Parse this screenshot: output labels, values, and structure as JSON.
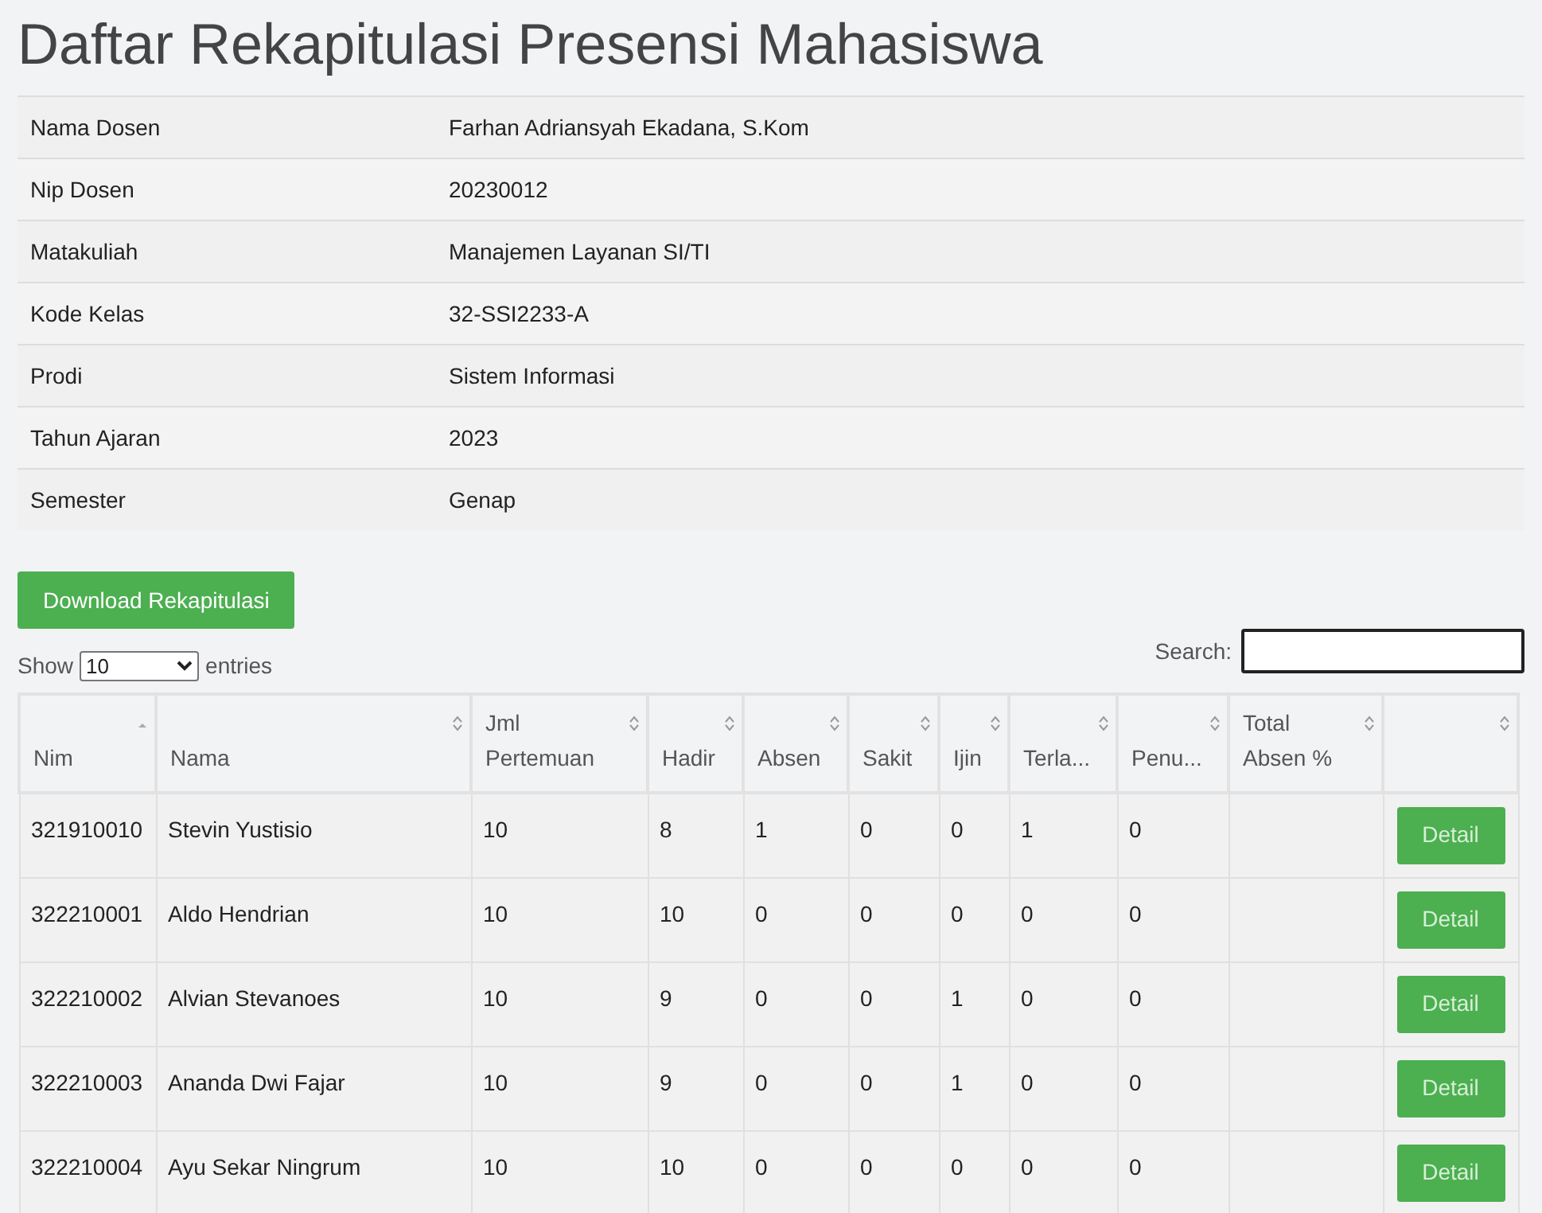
{
  "title": "Daftar Rekapitulasi Presensi Mahasiswa",
  "info": [
    {
      "label": "Nama Dosen",
      "value": "Farhan Adriansyah Ekadana, S.Kom"
    },
    {
      "label": "Nip Dosen",
      "value": "20230012"
    },
    {
      "label": "Matakuliah",
      "value": "Manajemen Layanan SI/TI"
    },
    {
      "label": "Kode Kelas",
      "value": "32-SSI2233-A"
    },
    {
      "label": "Prodi",
      "value": "Sistem Informasi"
    },
    {
      "label": "Tahun Ajaran",
      "value": "2023"
    },
    {
      "label": "Semester",
      "value": "Genap"
    }
  ],
  "download_button": "Download Rekapitulasi",
  "length": {
    "before": "Show",
    "value": "10",
    "after": "entries"
  },
  "search": {
    "label": "Search:"
  },
  "table": {
    "columns": [
      {
        "label": [
          "Nim"
        ],
        "sorted": true
      },
      {
        "label": [
          "Nama"
        ],
        "sorted": false
      },
      {
        "label": [
          "Jml",
          "Pertemuan"
        ],
        "sorted": false
      },
      {
        "label": [
          "Hadir"
        ],
        "sorted": false
      },
      {
        "label": [
          "Absen"
        ],
        "sorted": false
      },
      {
        "label": [
          "Sakit"
        ],
        "sorted": false
      },
      {
        "label": [
          "Ijin"
        ],
        "sorted": false
      },
      {
        "label": [
          "Terla..."
        ],
        "sorted": false
      },
      {
        "label": [
          "Penu..."
        ],
        "sorted": false
      },
      {
        "label": [
          "Total",
          "Absen %"
        ],
        "sorted": false
      },
      {
        "sorted": false
      }
    ],
    "rows": [
      {
        "cells": [
          "321910010",
          "Stevin Yustisio",
          "10",
          "8",
          "1",
          "0",
          "0",
          "1",
          "0"
        ],
        "action": "Detail"
      },
      {
        "cells": [
          "322210001",
          "Aldo Hendrian",
          "10",
          "10",
          "0",
          "0",
          "0",
          "0",
          "0"
        ],
        "action": "Detail"
      },
      {
        "cells": [
          "322210002",
          "Alvian Stevanoes",
          "10",
          "9",
          "0",
          "0",
          "1",
          "0",
          "0"
        ],
        "action": "Detail"
      },
      {
        "cells": [
          "322210003",
          "Ananda Dwi Fajar",
          "10",
          "9",
          "0",
          "0",
          "1",
          "0",
          "0"
        ],
        "action": "Detail"
      },
      {
        "cells": [
          "322210004",
          "Ayu Sekar Ningrum",
          "10",
          "10",
          "0",
          "0",
          "0",
          "0",
          "0"
        ],
        "action": "Detail"
      }
    ]
  }
}
